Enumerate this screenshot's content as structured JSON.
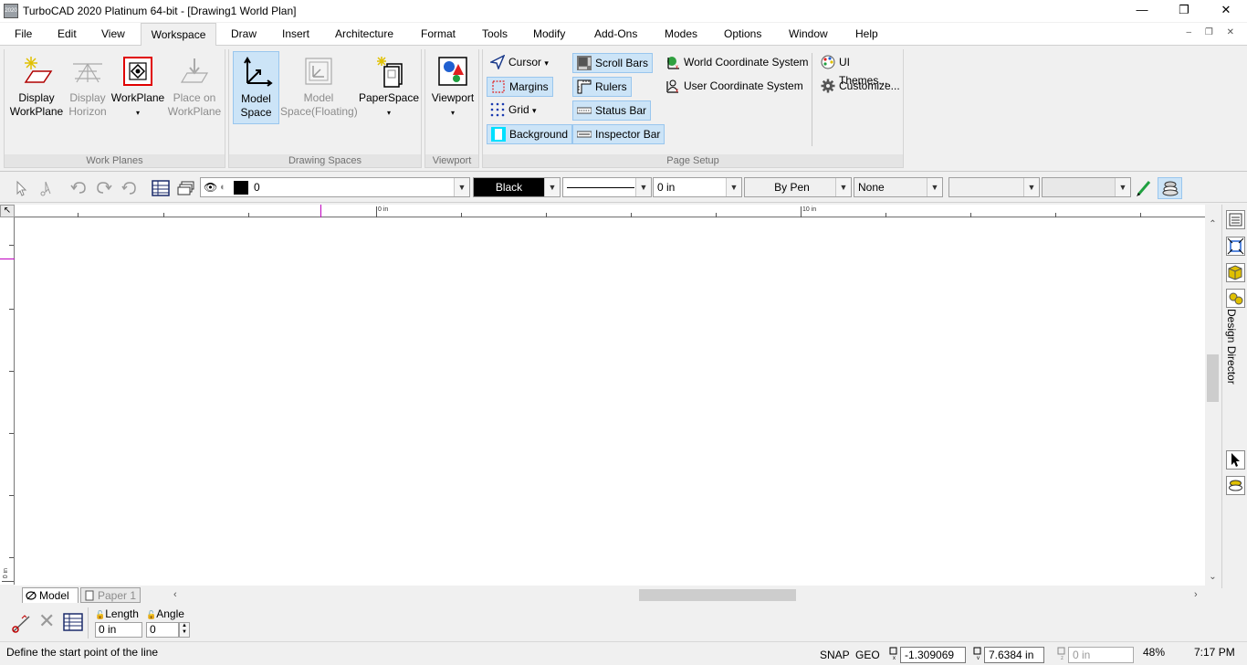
{
  "window": {
    "title": "TurboCAD 2020 Platinum 64-bit - [Drawing1 World Plan]",
    "app_icon_text": "2020",
    "controls": {
      "minimize": "—",
      "restore": "❐",
      "close": "✕"
    }
  },
  "menu": {
    "items": [
      "File",
      "Edit",
      "View",
      "Workspace",
      "Draw",
      "Insert",
      "Architecture",
      "Format",
      "Tools",
      "Modify",
      "Add-Ons",
      "Modes",
      "Options",
      "Window",
      "Help"
    ],
    "active": "Workspace",
    "mdi_controls": "– ❐ ✕"
  },
  "ribbon": {
    "work_planes": {
      "label": "Work Planes",
      "display_workplane": [
        "Display",
        "WorkPlane"
      ],
      "display_horizon": [
        "Display",
        "Horizon"
      ],
      "workplane": "WorkPlane",
      "place_on_workplane": [
        "Place on",
        "WorkPlane"
      ]
    },
    "drawing_spaces": {
      "label": "Drawing Spaces",
      "model_space": [
        "Model",
        "Space"
      ],
      "model_space_floating": [
        "Model",
        "Space(Floating)"
      ],
      "paperspace": "PaperSpace"
    },
    "viewport": {
      "label": "Viewport",
      "viewport": "Viewport"
    },
    "page_setup": {
      "label": "Page Setup",
      "cursor": "Cursor",
      "margins": "Margins",
      "grid": "Grid",
      "background": "Background",
      "scroll_bars": "Scroll Bars",
      "rulers": "Rulers",
      "status_bar": "Status Bar",
      "inspector_bar": "Inspector Bar",
      "world_cs": "World Coordinate System",
      "user_cs": "User Coordinate System"
    },
    "themes": {
      "ui_themes": "UI Themes...",
      "customize": "Customize..."
    }
  },
  "toolbar": {
    "layer_value": "0",
    "color_value": "Black",
    "width_value": "0 in",
    "pen_value": "By Pen",
    "fill_value": "None",
    "extra1": "",
    "extra2": ""
  },
  "ruler": {
    "label_0": "0 in",
    "label_10": "10 in",
    "left_label": "0 in"
  },
  "tabs": {
    "model": "Model",
    "paper": "Paper 1"
  },
  "sidebar": {
    "label": "Design Director"
  },
  "inspector": {
    "length_label": "Length",
    "angle_label": "Angle",
    "length_value": "0 in",
    "angle_value": "0"
  },
  "status": {
    "message": "Define the start point of the line",
    "snap": "SNAP",
    "geo": "GEO",
    "x": "-1.309069 in",
    "y": "7.6384 in",
    "z": "0 in",
    "zoom": "48%",
    "time": "7:17 PM"
  },
  "colors": {
    "accent_selected": "#cce4f7",
    "workplane_red": "#e00000",
    "canvas": "#ffffff"
  }
}
